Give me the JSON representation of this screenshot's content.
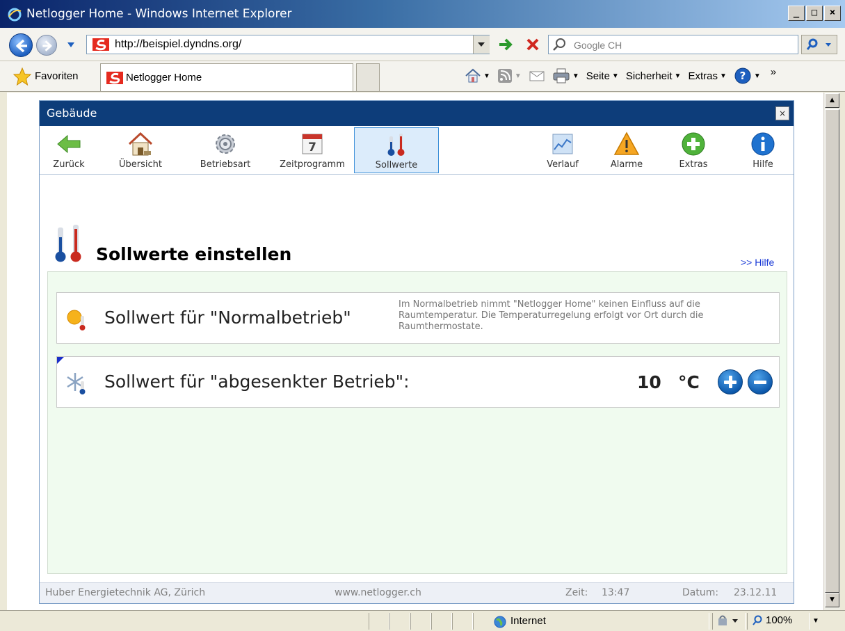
{
  "window": {
    "title": "Netlogger Home - Windows Internet Explorer",
    "min_label": "_",
    "max_label": "□",
    "close_label": "×"
  },
  "address": {
    "url": "http://beispiel.dyndns.org/",
    "search_placeholder": "Google CH"
  },
  "favorites": {
    "label": "Favoriten",
    "tab_title": "Netlogger Home"
  },
  "commands": {
    "page": "Seite",
    "security": "Sicherheit",
    "extras": "Extras",
    "more": "»"
  },
  "app": {
    "header_title": "Gebäude",
    "close_label": "×",
    "toolbar": {
      "back": "Zurück",
      "overview": "Übersicht",
      "mode": "Betriebsart",
      "schedule": "Zeitprogramm",
      "setpoints": "Sollwerte",
      "history": "Verlauf",
      "alarms": "Alarme",
      "extras": "Extras",
      "help": "Hilfe"
    },
    "calendar_day": "7",
    "section_title": "Sollwerte einstellen",
    "help_link": ">> Hilfe",
    "rows": {
      "normal": {
        "label": "Sollwert für \"Normalbetrieb\"",
        "description": "Im Normalbetrieb nimmt \"Netlogger Home\" keinen Einfluss auf die Raumtemperatur. Die Temperaturregelung erfolgt vor Ort durch die Raumthermostate."
      },
      "reduced": {
        "label": "Sollwert für \"abgesenkter Betrieb\":",
        "value": "10",
        "unit": "°C"
      }
    },
    "footer": {
      "company": "Huber Energietechnik AG, Zürich",
      "website": "www.netlogger.ch",
      "time_label": "Zeit:",
      "time": "13:47",
      "date_label": "Datum:",
      "date": "23.12.11"
    }
  },
  "status": {
    "zone": "Internet",
    "zoom": "100%"
  },
  "colors": {
    "app_header": "#0d3d7a",
    "content_bg": "#f0fbef",
    "accent_blue": "#0a55a8"
  }
}
